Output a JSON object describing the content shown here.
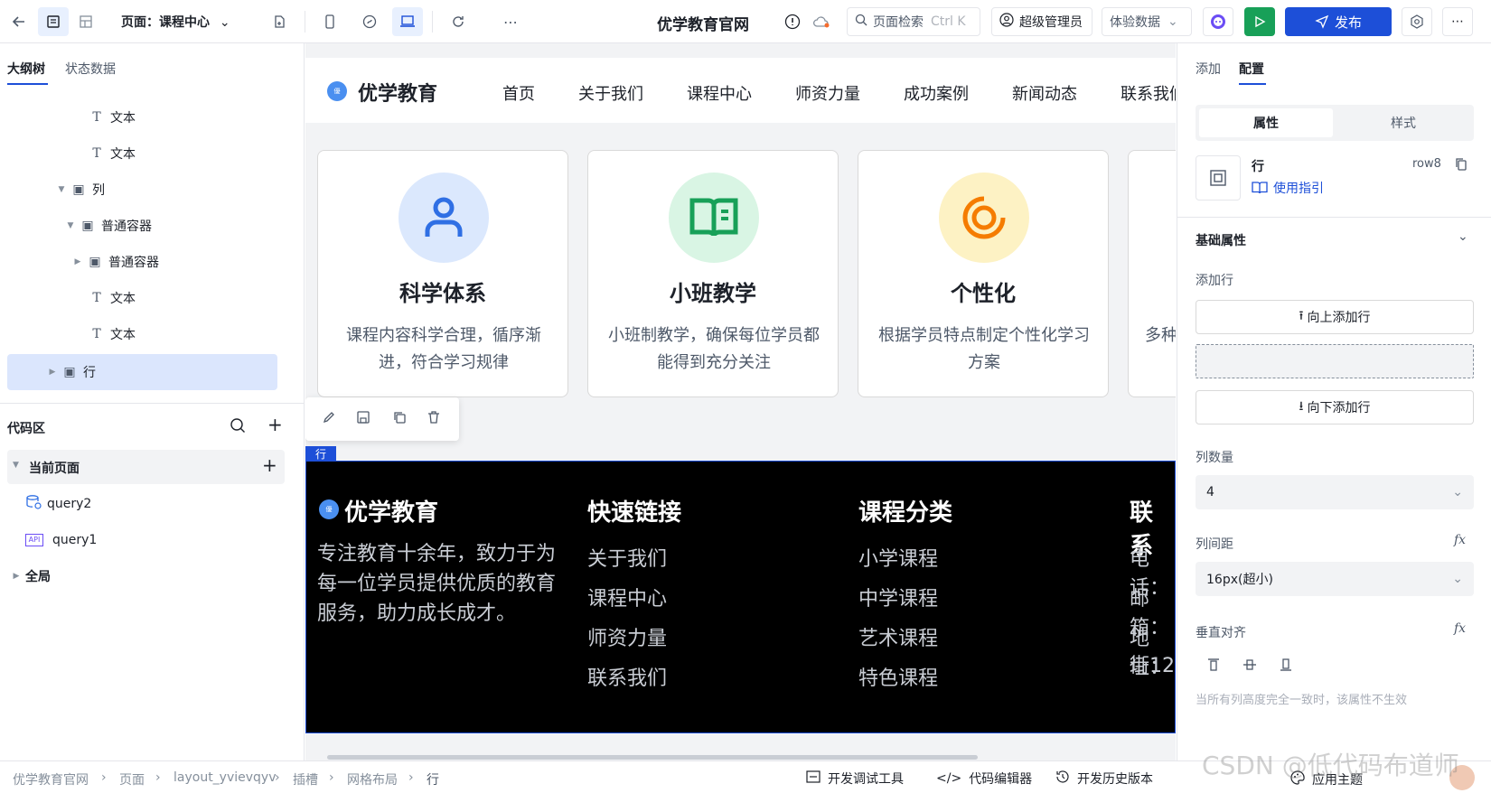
{
  "topbar": {
    "page_label": "页面：课程中心",
    "site_title": "优学教育官网",
    "search_placeholder": "页面检索",
    "search_shortcut": "Ctrl K",
    "user": "超级管理员",
    "env": "体验数据",
    "publish": "发布"
  },
  "left": {
    "tabs": [
      "大纲树",
      "状态数据"
    ],
    "tree": [
      {
        "label": "文本",
        "icon": "T"
      },
      {
        "label": "文本",
        "icon": "T"
      },
      {
        "label": "列",
        "icon": "▣"
      },
      {
        "label": "普通容器",
        "icon": "▣"
      },
      {
        "label": "普通容器",
        "icon": "▣"
      },
      {
        "label": "文本",
        "icon": "T"
      },
      {
        "label": "文本",
        "icon": "T"
      },
      {
        "label": "行",
        "icon": "▣"
      }
    ],
    "code_title": "代码区",
    "current_page": "当前页面",
    "queries": [
      "query2",
      "query1"
    ],
    "global": "全局"
  },
  "canvas": {
    "logo_text": "优学教育",
    "nav": [
      "首页",
      "关于我们",
      "课程中心",
      "师资力量",
      "成功案例",
      "新闻动态",
      "联系我们"
    ],
    "cards": [
      {
        "title": "科学体系",
        "desc": "课程内容科学合理，循序渐进，符合学习规律",
        "bg": "#dbe8fd",
        "fg": "#2f6fe4"
      },
      {
        "title": "小班教学",
        "desc": "小班制教学，确保每位学员都能得到充分关注",
        "bg": "#d9f5e4",
        "fg": "#18a058"
      },
      {
        "title": "个性化",
        "desc": "根据学员特点制定个性化学习方案",
        "bg": "#fdf2c4",
        "fg": "#f57c00"
      },
      {
        "title": "",
        "desc": "多种",
        "bg": "#ffffff",
        "fg": "#999999"
      }
    ],
    "row_tag": "行",
    "footer": {
      "brand": "优学教育",
      "brand_desc": "专注教育十余年，致力于为每一位学员提供优质的教育服务，助力成长成才。",
      "links_title": "快速链接",
      "links": [
        "关于我们",
        "课程中心",
        "师资力量",
        "联系我们"
      ],
      "cat_title": "课程分类",
      "cats": [
        "小学课程",
        "中学课程",
        "艺术课程",
        "特色课程"
      ],
      "contact_title": "联系",
      "contacts": [
        "电话：",
        "邮箱：",
        "地址：",
        "街12"
      ]
    }
  },
  "right": {
    "tabs": [
      "添加",
      "配置"
    ],
    "segment": [
      "属性",
      "样式"
    ],
    "component_name": "行",
    "component_id": "row8",
    "guide": "使用指引",
    "section": "基础属性",
    "add_row_label": "添加行",
    "add_up": "向上添加行",
    "add_down": "向下添加行",
    "col_count_label": "列数量",
    "col_count": "4",
    "col_gap_label": "列间距",
    "col_gap": "16px(超小)",
    "valign_label": "垂直对齐",
    "hint": "当所有列高度完全一致时，该属性不生效"
  },
  "status": {
    "crumbs": [
      "优学教育官网",
      "页面",
      "layout_yvievqyv",
      "插槽",
      "网格布局",
      "行"
    ],
    "tools": [
      "开发调试工具",
      "代码编辑器",
      "开发历史版本",
      "应用主题"
    ],
    "watermark": "CSDN @低代码布道师"
  }
}
